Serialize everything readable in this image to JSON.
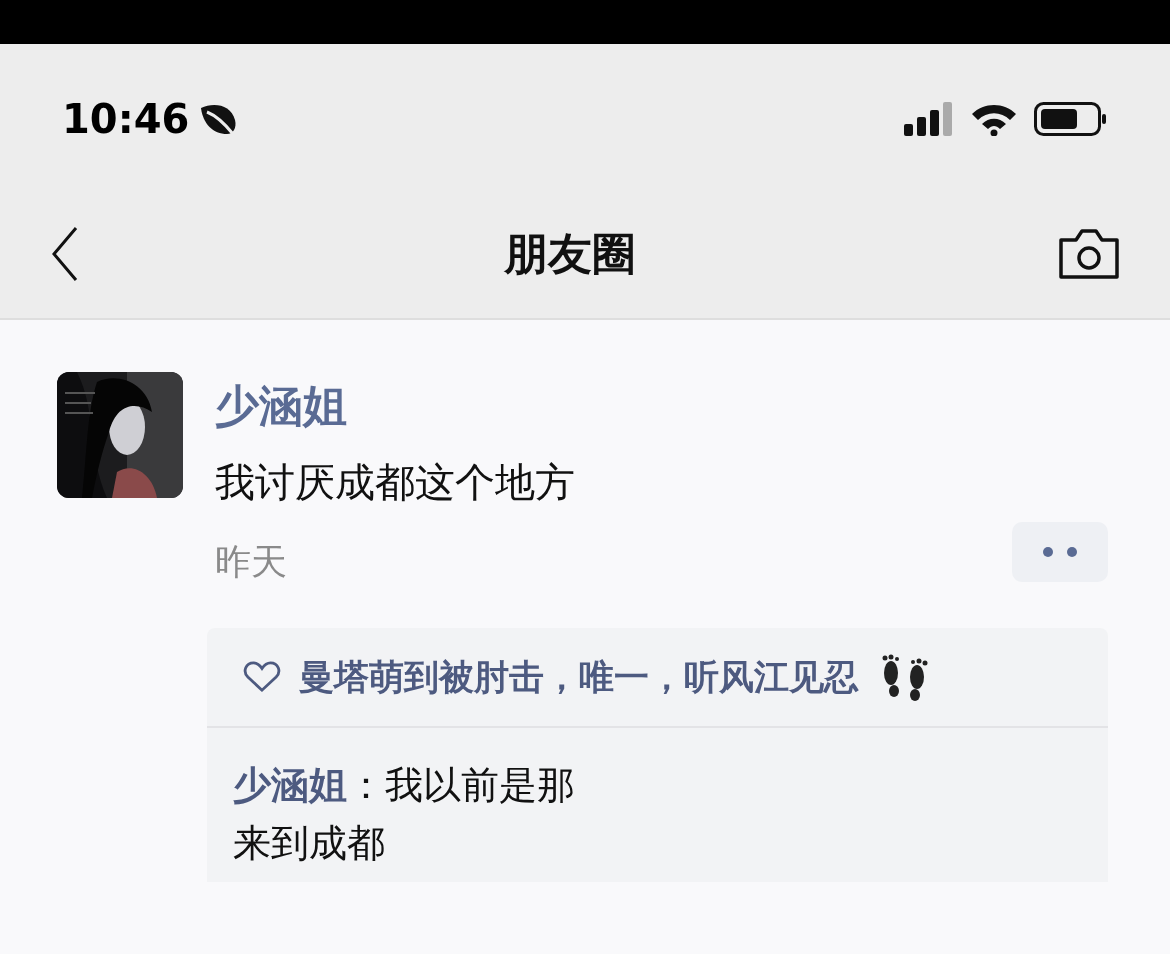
{
  "status_bar": {
    "time": "10:46"
  },
  "nav": {
    "title": "朋友圈"
  },
  "post": {
    "author": "少涵姐",
    "text": "我讨厌成都这个地方",
    "time": "昨天",
    "likes": "曼塔萌到被肘击，唯一，听风江见忍",
    "comments": [
      {
        "author": "少涵姐",
        "lines": [
          "：我以前是那",
          "来到成都"
        ]
      }
    ]
  }
}
